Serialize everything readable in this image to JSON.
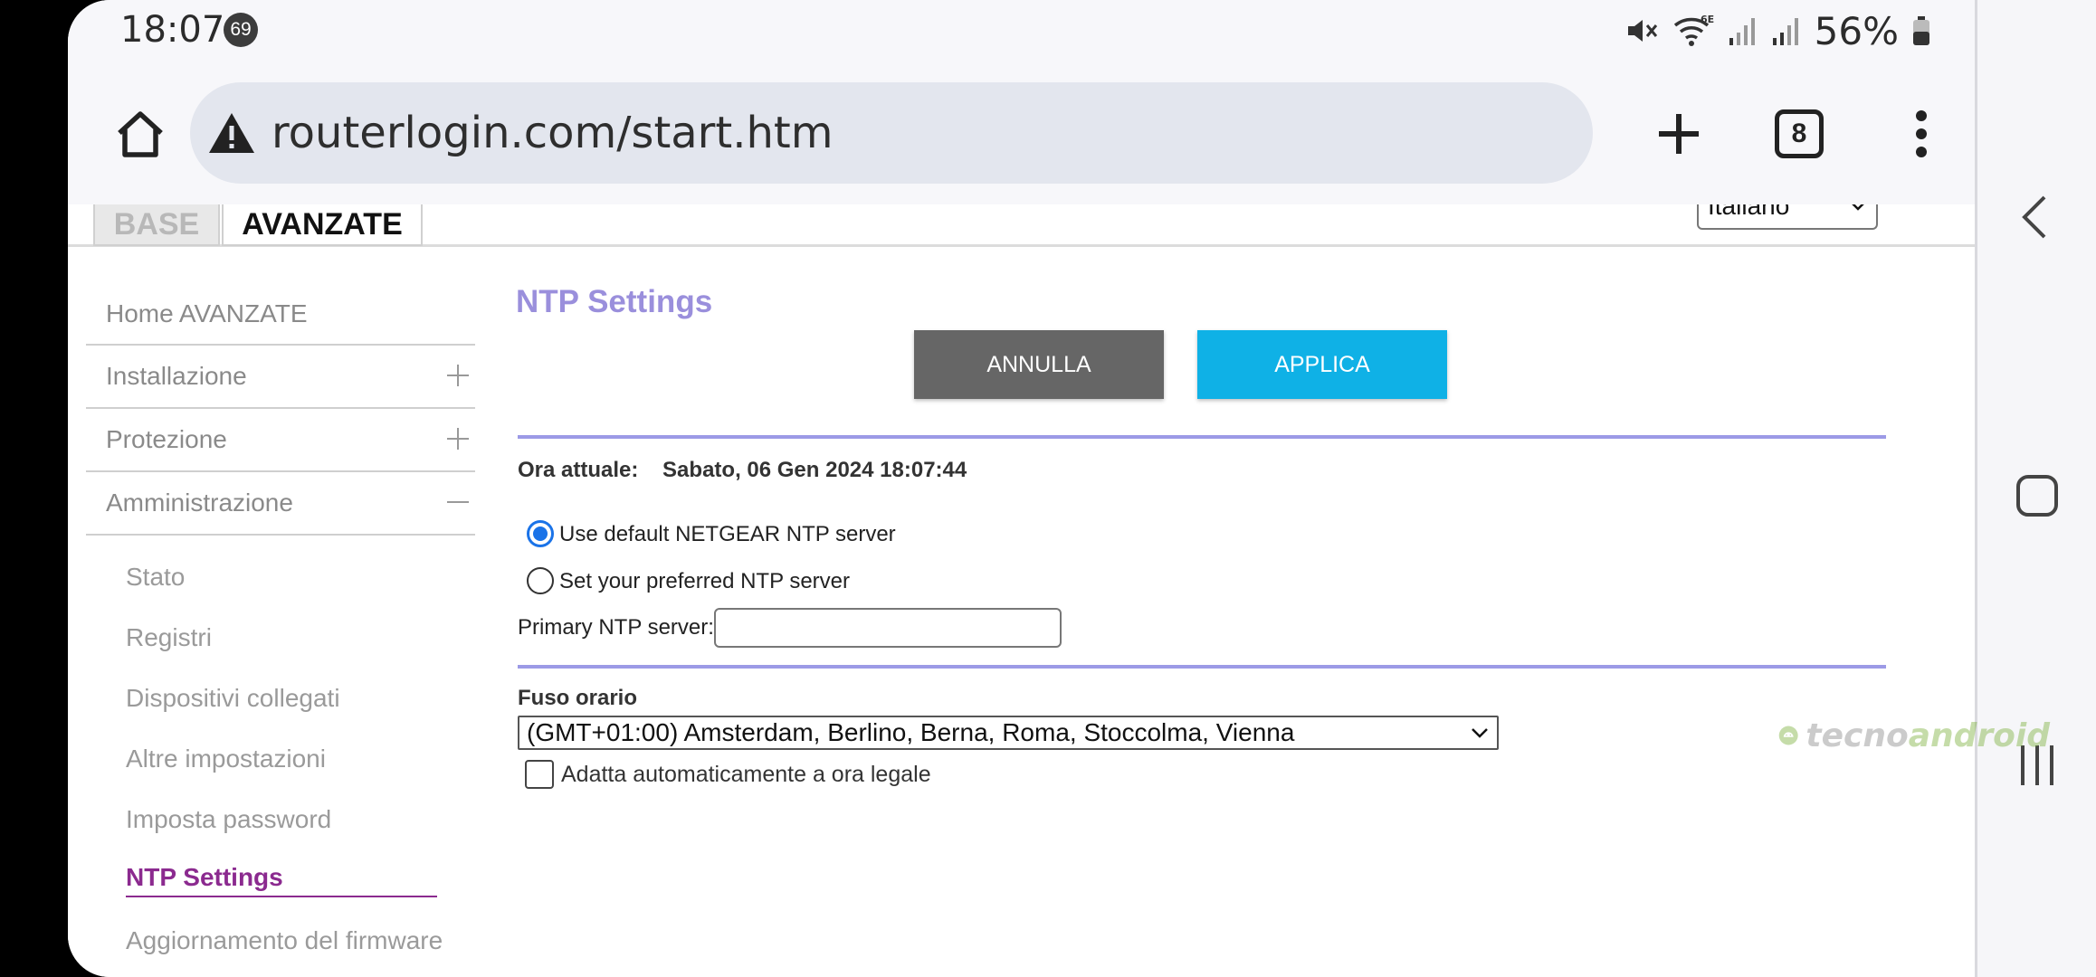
{
  "status_bar": {
    "time": "18:07",
    "notification_count": "69",
    "battery": "56%"
  },
  "browser": {
    "url": "routerlogin.com/start.htm",
    "tab_count": "8"
  },
  "router_nav": {
    "tab_base": "BASE",
    "tab_advanced": "AVANZATE",
    "language": "Italiano"
  },
  "sidebar": {
    "home": "Home AVANZATE",
    "sections": [
      {
        "label": "Installazione",
        "expanded": false
      },
      {
        "label": "Protezione",
        "expanded": false
      },
      {
        "label": "Amministrazione",
        "expanded": true
      }
    ],
    "sub_items": [
      "Stato",
      "Registri",
      "Dispositivi collegati",
      "Altre impostazioni",
      "Imposta password",
      "NTP Settings",
      "Aggiornamento del firmware"
    ],
    "active_item": "NTP Settings"
  },
  "content": {
    "title": "NTP Settings",
    "cancel_label": "ANNULLA",
    "apply_label": "APPLICA",
    "current_time_label": "Ora attuale:",
    "current_time_value": "Sabato, 06 Gen 2024 18:07:44",
    "radio_default": "Use default NETGEAR NTP server",
    "radio_custom": "Set your preferred NTP server",
    "radio_selected": "default",
    "primary_ntp_label": "Primary NTP server:",
    "primary_ntp_value": "",
    "timezone_label": "Fuso orario",
    "timezone_value": "(GMT+01:00) Amsterdam, Berlino, Berna, Roma, Stoccolma, Vienna",
    "dst_label": "Adatta automaticamente a ora legale",
    "dst_checked": false
  },
  "watermark": {
    "brand_prefix": "tecno",
    "brand_suffix": "android"
  },
  "colors": {
    "title": "#9a8fdc",
    "rule": "#9c9ae6",
    "active_nav": "#8b2a8f",
    "apply": "#0fb1e6",
    "cancel": "#666666"
  }
}
